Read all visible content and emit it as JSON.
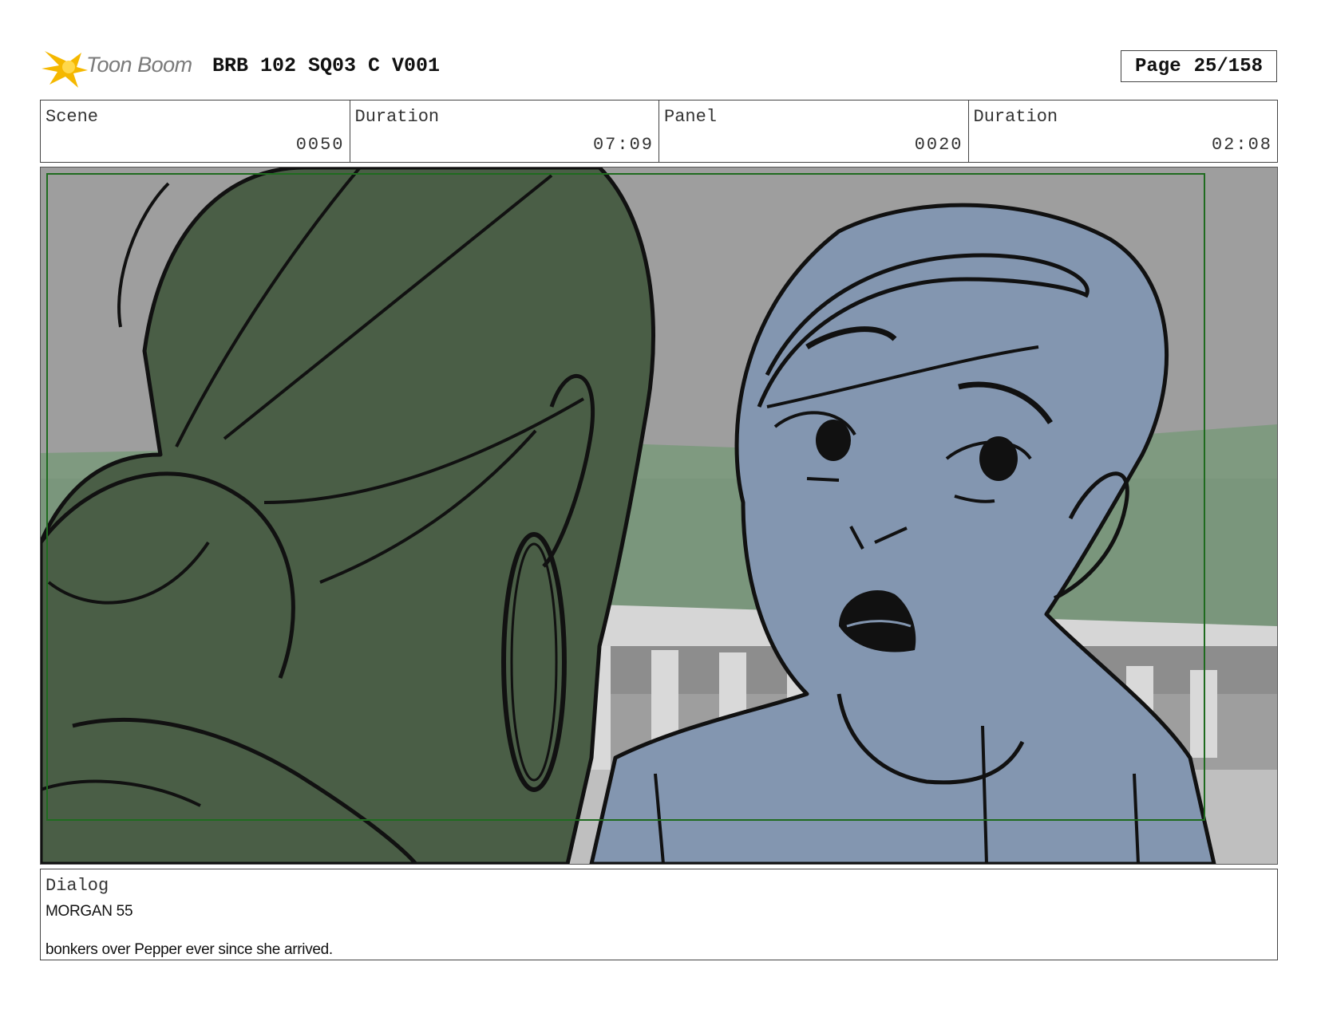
{
  "header": {
    "logo_text": "Toon Boom",
    "title": "BRB 102 SQ03 C V001",
    "page_label": "Page",
    "page_value": "25/158"
  },
  "info": {
    "scene_label": "Scene",
    "scene_value": "0050",
    "scene_duration_label": "Duration",
    "scene_duration_value": "07:09",
    "panel_label": "Panel",
    "panel_value": "0020",
    "panel_duration_label": "Duration",
    "panel_duration_value": "02:08"
  },
  "dialog": {
    "label": "Dialog",
    "speaker": "MORGAN 55",
    "line": "bonkers over Pepper ever since she arrived."
  },
  "colors": {
    "accent_logo": "#f5b800",
    "foreground_character": "#4a5e46",
    "second_character": "#8396b0",
    "sky": "#9e9e9e",
    "lawn": "#7a967c",
    "frame_guide": "#1f6b1f"
  }
}
